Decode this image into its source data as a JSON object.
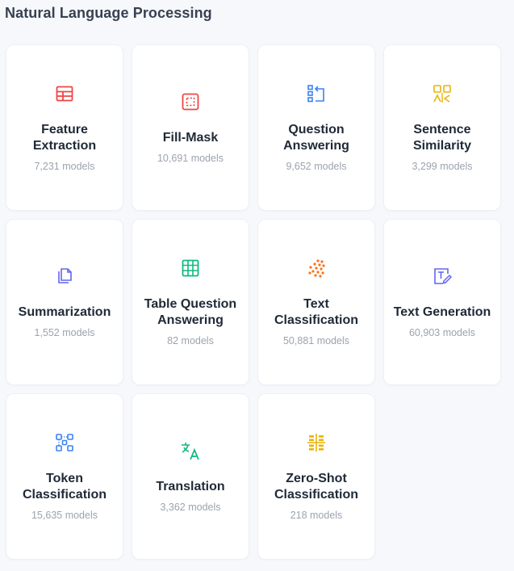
{
  "section": {
    "title": "Natural Language Processing"
  },
  "tasks": [
    {
      "name": "Feature Extraction",
      "count": "7,231 models",
      "icon": "feature-extraction-icon",
      "color": "#ef4444"
    },
    {
      "name": "Fill-Mask",
      "count": "10,691 models",
      "icon": "fill-mask-icon",
      "color": "#ef4444"
    },
    {
      "name": "Question Answering",
      "count": "9,652 models",
      "icon": "question-answering-icon",
      "color": "#3b82f6"
    },
    {
      "name": "Sentence Similarity",
      "count": "3,299 models",
      "icon": "sentence-similarity-icon",
      "color": "#eab308"
    },
    {
      "name": "Summarization",
      "count": "1,552 models",
      "icon": "summarization-icon",
      "color": "#6366f1"
    },
    {
      "name": "Table Question Answering",
      "count": "82 models",
      "icon": "table-question-answering-icon",
      "color": "#10b981"
    },
    {
      "name": "Text Classification",
      "count": "50,881 models",
      "icon": "text-classification-icon",
      "color": "#f97316"
    },
    {
      "name": "Text Generation",
      "count": "60,903 models",
      "icon": "text-generation-icon",
      "color": "#6366f1"
    },
    {
      "name": "Token Classification",
      "count": "15,635 models",
      "icon": "token-classification-icon",
      "color": "#3b82f6"
    },
    {
      "name": "Translation",
      "count": "3,362 models",
      "icon": "translation-icon",
      "color": "#10b981"
    },
    {
      "name": "Zero-Shot Classification",
      "count": "218 models",
      "icon": "zero-shot-classification-icon",
      "color": "#eab308"
    }
  ]
}
